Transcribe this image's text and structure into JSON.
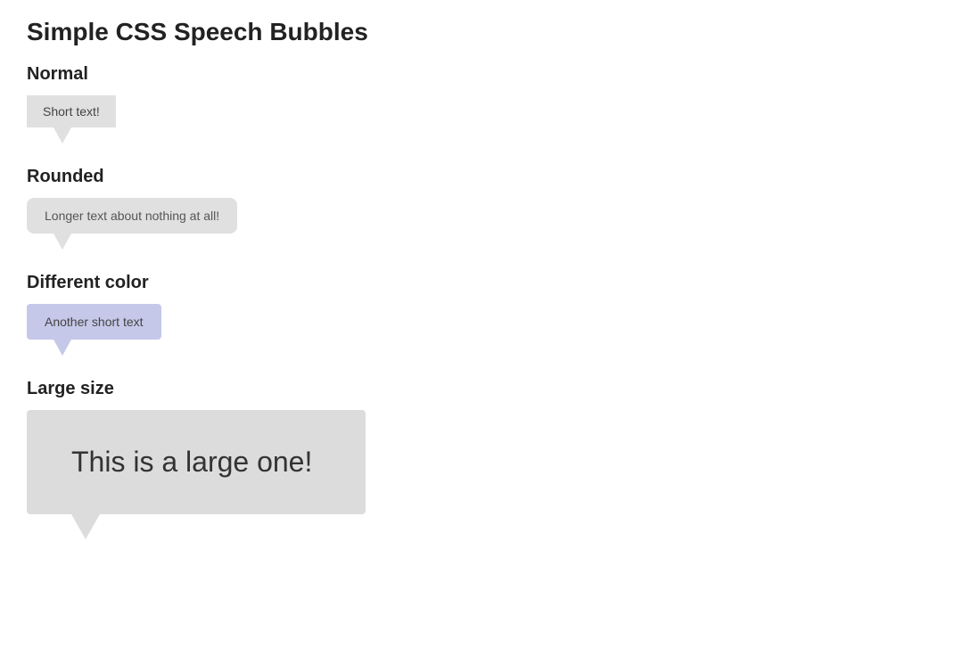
{
  "page": {
    "title": "Simple CSS Speech Bubbles",
    "sections": [
      {
        "id": "normal",
        "label": "Normal",
        "bubble_text": "Short text!",
        "style": "normal"
      },
      {
        "id": "rounded",
        "label": "Rounded",
        "bubble_text": "Longer text about nothing at all!",
        "style": "rounded"
      },
      {
        "id": "different-color",
        "label": "Different color",
        "bubble_text": "Another short text",
        "style": "color"
      },
      {
        "id": "large-size",
        "label": "Large size",
        "bubble_text": "This is a large one!",
        "style": "large"
      }
    ]
  }
}
